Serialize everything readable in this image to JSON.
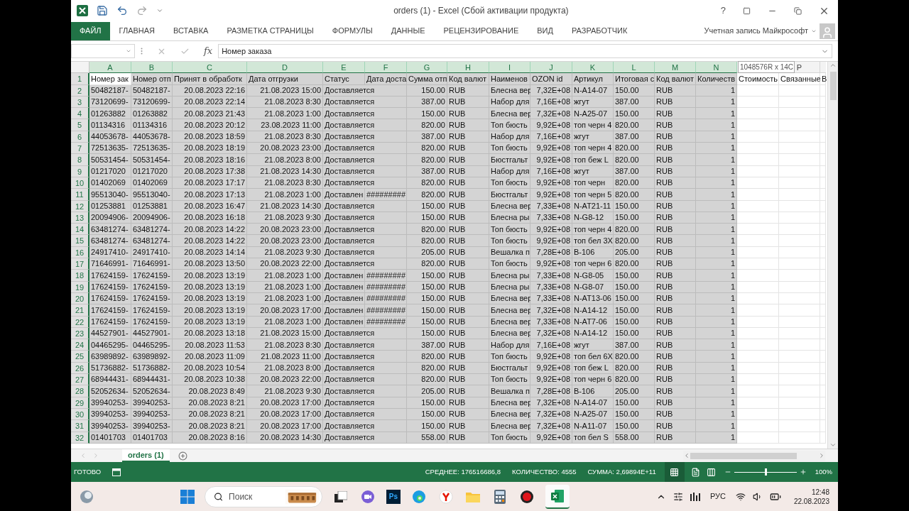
{
  "window": {
    "title": "orders (1) - Excel (Сбой активации продукта)",
    "help": "?"
  },
  "ribbon_tabs": [
    {
      "label": "ФАЙЛ",
      "kind": "file"
    },
    {
      "label": "ГЛАВНАЯ",
      "kind": "tab"
    },
    {
      "label": "ВСТАВКА",
      "kind": "tab"
    },
    {
      "label": "РАЗМЕТКА СТРАНИЦЫ",
      "kind": "tab"
    },
    {
      "label": "ФОРМУЛЫ",
      "kind": "tab"
    },
    {
      "label": "ДАННЫЕ",
      "kind": "tab"
    },
    {
      "label": "РЕЦЕНЗИРОВАНИЕ",
      "kind": "tab"
    },
    {
      "label": "ВИД",
      "kind": "tab"
    },
    {
      "label": "РАЗРАБОТЧИК",
      "kind": "tab"
    }
  ],
  "account": "Учетная запись Майкрософт",
  "formula_bar": {
    "function_label": "fx",
    "content": "Номер заказа"
  },
  "column_headers": [
    {
      "label": "A",
      "selected": true
    },
    {
      "label": "B",
      "selected": true
    },
    {
      "label": "C",
      "selected": true
    },
    {
      "label": "D",
      "selected": true
    },
    {
      "label": "E",
      "selected": true
    },
    {
      "label": "F",
      "selected": true
    },
    {
      "label": "G",
      "selected": true
    },
    {
      "label": "H",
      "selected": true
    },
    {
      "label": "I",
      "selected": true
    },
    {
      "label": "J",
      "selected": true
    },
    {
      "label": "K",
      "selected": true
    },
    {
      "label": "L",
      "selected": true
    },
    {
      "label": "M",
      "selected": true
    },
    {
      "label": "N",
      "selected": true
    },
    {
      "tooltip": "1048576R x 14C",
      "selected": false
    },
    {
      "label": "P",
      "selected": false
    }
  ],
  "rows": [
    {
      "number": "1",
      "selected": true,
      "active": true,
      "A": "Номер зак",
      "B": "Номер отп",
      "C": "Принят в обработк",
      "D": "Дата отгрузки",
      "E": "Статус",
      "F": "Дата доста",
      "G": "Сумма отп",
      "H": "Код валют",
      "I": "Наименов",
      "J": "OZON id",
      "K": "Артикул",
      "L": "Итоговая с",
      "M": "Код валют",
      "N": "Количеств",
      "O": "Стоимость",
      "P": "Связанные",
      "Q": "В"
    },
    {
      "number": "2",
      "selected": true,
      "active": false,
      "A": "50482187-",
      "B": "50482187-",
      "C": "20.08.2023 22:16",
      "D": "21.08.2023 15:00",
      "E": "Доставляется",
      "G": "150.00",
      "H": "RUB",
      "I": "Блесна вер",
      "J": "7,32E+08",
      "K": "N-A14-07",
      "L": "150.00",
      "M": "RUB",
      "N": "1"
    },
    {
      "number": "3",
      "selected": true,
      "active": false,
      "A": "73120699-",
      "B": "73120699-",
      "C": "20.08.2023 22:14",
      "D": "21.08.2023 8:30",
      "E": "Доставляется",
      "G": "387.00",
      "H": "RUB",
      "I": "Набор для",
      "J": "7,16E+08",
      "K": "жгут",
      "L": "387.00",
      "M": "RUB",
      "N": "1"
    },
    {
      "number": "4",
      "selected": true,
      "active": false,
      "A": "01263882",
      "B": "01263882",
      "C": "20.08.2023 21:43",
      "D": "21.08.2023 1:00",
      "E": "Доставляется",
      "G": "150.00",
      "H": "RUB",
      "I": "Блесна вер",
      "J": "7,32E+08",
      "K": "N-A25-07",
      "L": "150.00",
      "M": "RUB",
      "N": "1"
    },
    {
      "number": "5",
      "selected": true,
      "active": false,
      "A": "01134316",
      "B": "01134316",
      "C": "20.08.2023 20:12",
      "D": "23.08.2023 11:00",
      "E": "Доставляется",
      "G": "820.00",
      "H": "RUB",
      "I": "Топ бюсть",
      "J": "9,92E+08",
      "K": "топ черн 4",
      "L": "820.00",
      "M": "RUB",
      "N": "1"
    },
    {
      "number": "6",
      "selected": true,
      "active": false,
      "A": "44053678-",
      "B": "44053678-",
      "C": "20.08.2023 18:59",
      "D": "21.08.2023 8:30",
      "E": "Доставляется",
      "G": "387.00",
      "H": "RUB",
      "I": "Набор для",
      "J": "7,16E+08",
      "K": "жгут",
      "L": "387.00",
      "M": "RUB",
      "N": "1"
    },
    {
      "number": "7",
      "selected": true,
      "active": false,
      "A": "72513635-",
      "B": "72513635-",
      "C": "20.08.2023 18:19",
      "D": "20.08.2023 23:00",
      "E": "Доставляется",
      "G": "820.00",
      "H": "RUB",
      "I": "Топ бюсть",
      "J": "9,92E+08",
      "K": "топ черн 4",
      "L": "820.00",
      "M": "RUB",
      "N": "1"
    },
    {
      "number": "8",
      "selected": true,
      "active": false,
      "A": "50531454-",
      "B": "50531454-",
      "C": "20.08.2023 18:16",
      "D": "21.08.2023 8:00",
      "E": "Доставляется",
      "G": "820.00",
      "H": "RUB",
      "I": "Бюстгальт",
      "J": "9,92E+08",
      "K": "топ беж L",
      "L": "820.00",
      "M": "RUB",
      "N": "1"
    },
    {
      "number": "9",
      "selected": true,
      "active": false,
      "A": "01217020",
      "B": "01217020",
      "C": "20.08.2023 17:38",
      "D": "21.08.2023 14:30",
      "E": "Доставляется",
      "G": "387.00",
      "H": "RUB",
      "I": "Набор для",
      "J": "7,16E+08",
      "K": "жгут",
      "L": "387.00",
      "M": "RUB",
      "N": "1"
    },
    {
      "number": "10",
      "selected": true,
      "active": false,
      "A": "01402069",
      "B": "01402069",
      "C": "20.08.2023 17:17",
      "D": "21.08.2023 8:30",
      "E": "Доставляется",
      "G": "820.00",
      "H": "RUB",
      "I": "Топ бюсть",
      "J": "9,92E+08",
      "K": "топ черн",
      "L": "820.00",
      "M": "RUB",
      "N": "1"
    },
    {
      "number": "11",
      "selected": true,
      "active": false,
      "A": "95513040-",
      "B": "95513040-",
      "C": "20.08.2023 17:13",
      "D": "21.08.2023 1:00",
      "E": "Доставлен",
      "F": "#########",
      "G": "820.00",
      "H": "RUB",
      "I": "Бюстгальт",
      "J": "9,92E+08",
      "K": "топ черн 5",
      "L": "820.00",
      "M": "RUB",
      "N": "1"
    },
    {
      "number": "12",
      "selected": true,
      "active": false,
      "A": "01253881",
      "B": "01253881",
      "C": "20.08.2023 16:47",
      "D": "21.08.2023 14:30",
      "E": "Доставляется",
      "G": "150.00",
      "H": "RUB",
      "I": "Блесна вер",
      "J": "7,33E+08",
      "K": "N-AT21-11",
      "L": "150.00",
      "M": "RUB",
      "N": "1"
    },
    {
      "number": "13",
      "selected": true,
      "active": false,
      "A": "20094906-",
      "B": "20094906-",
      "C": "20.08.2023 16:18",
      "D": "21.08.2023 9:30",
      "E": "Доставляется",
      "G": "150.00",
      "H": "RUB",
      "I": "Блесна ры",
      "J": "7,33E+08",
      "K": "N-G8-12",
      "L": "150.00",
      "M": "RUB",
      "N": "1"
    },
    {
      "number": "14",
      "selected": true,
      "active": false,
      "A": "63481274-",
      "B": "63481274-",
      "C": "20.08.2023 14:22",
      "D": "20.08.2023 23:00",
      "E": "Доставляется",
      "G": "820.00",
      "H": "RUB",
      "I": "Топ бюсть",
      "J": "9,92E+08",
      "K": "топ черн 4",
      "L": "820.00",
      "M": "RUB",
      "N": "1"
    },
    {
      "number": "15",
      "selected": true,
      "active": false,
      "A": "63481274-",
      "B": "63481274-",
      "C": "20.08.2023 14:22",
      "D": "20.08.2023 23:00",
      "E": "Доставляется",
      "G": "820.00",
      "H": "RUB",
      "I": "Топ бюсть",
      "J": "9,92E+08",
      "K": "топ бел 3Х",
      "L": "820.00",
      "M": "RUB",
      "N": "1"
    },
    {
      "number": "16",
      "selected": true,
      "active": false,
      "A": "24917410-",
      "B": "24917410-",
      "C": "20.08.2023 14:14",
      "D": "21.08.2023 9:30",
      "E": "Доставляется",
      "G": "205.00",
      "H": "RUB",
      "I": "Вешалка п",
      "J": "7,28E+08",
      "K": "B-106",
      "L": "205.00",
      "M": "RUB",
      "N": "1"
    },
    {
      "number": "17",
      "selected": true,
      "active": false,
      "A": "71646991-",
      "B": "71646991-",
      "C": "20.08.2023 13:50",
      "D": "20.08.2023 22:00",
      "E": "Доставляется",
      "G": "820.00",
      "H": "RUB",
      "I": "Топ бюсть",
      "J": "9,92E+08",
      "K": "топ черн 6",
      "L": "820.00",
      "M": "RUB",
      "N": "1"
    },
    {
      "number": "18",
      "selected": true,
      "active": false,
      "A": "17624159-",
      "B": "17624159-",
      "C": "20.08.2023 13:19",
      "D": "21.08.2023 1:00",
      "E": "Доставлен",
      "F": "#########",
      "G": "150.00",
      "H": "RUB",
      "I": "Блесна ры",
      "J": "7,33E+08",
      "K": "N-G8-05",
      "L": "150.00",
      "M": "RUB",
      "N": "1"
    },
    {
      "number": "19",
      "selected": true,
      "active": false,
      "A": "17624159-",
      "B": "17624159-",
      "C": "20.08.2023 13:19",
      "D": "21.08.2023 1:00",
      "E": "Доставлен",
      "F": "#########",
      "G": "150.00",
      "H": "RUB",
      "I": "Блесна ры",
      "J": "7,33E+08",
      "K": "N-G8-07",
      "L": "150.00",
      "M": "RUB",
      "N": "1"
    },
    {
      "number": "20",
      "selected": true,
      "active": false,
      "A": "17624159-",
      "B": "17624159-",
      "C": "20.08.2023 13:19",
      "D": "21.08.2023 1:00",
      "E": "Доставлен",
      "F": "#########",
      "G": "150.00",
      "H": "RUB",
      "I": "Блесна вер",
      "J": "7,33E+08",
      "K": "N-AT13-06",
      "L": "150.00",
      "M": "RUB",
      "N": "1"
    },
    {
      "number": "21",
      "selected": true,
      "active": false,
      "A": "17624159-",
      "B": "17624159-",
      "C": "20.08.2023 13:19",
      "D": "20.08.2023 17:00",
      "E": "Доставлен",
      "F": "#########",
      "G": "150.00",
      "H": "RUB",
      "I": "Блесна вер",
      "J": "7,32E+08",
      "K": "N-A14-12",
      "L": "150.00",
      "M": "RUB",
      "N": "1"
    },
    {
      "number": "22",
      "selected": true,
      "active": false,
      "A": "17624159-",
      "B": "17624159-",
      "C": "20.08.2023 13:19",
      "D": "21.08.2023 1:00",
      "E": "Доставлен",
      "F": "#########",
      "G": "150.00",
      "H": "RUB",
      "I": "Блесна вер",
      "J": "7,33E+08",
      "K": "N-AT7-06",
      "L": "150.00",
      "M": "RUB",
      "N": "1"
    },
    {
      "number": "23",
      "selected": true,
      "active": false,
      "A": "44527901-",
      "B": "44527901-",
      "C": "20.08.2023 13:18",
      "D": "21.08.2023 15:00",
      "E": "Доставляется",
      "G": "150.00",
      "H": "RUB",
      "I": "Блесна вер",
      "J": "7,32E+08",
      "K": "N-A14-12",
      "L": "150.00",
      "M": "RUB",
      "N": "1"
    },
    {
      "number": "24",
      "selected": true,
      "active": false,
      "A": "04465295-",
      "B": "04465295-",
      "C": "20.08.2023 11:53",
      "D": "21.08.2023 8:30",
      "E": "Доставляется",
      "G": "387.00",
      "H": "RUB",
      "I": "Набор для",
      "J": "7,16E+08",
      "K": "жгут",
      "L": "387.00",
      "M": "RUB",
      "N": "1"
    },
    {
      "number": "25",
      "selected": true,
      "active": false,
      "A": "63989892-",
      "B": "63989892-",
      "C": "20.08.2023 11:09",
      "D": "21.08.2023 11:00",
      "E": "Доставляется",
      "G": "820.00",
      "H": "RUB",
      "I": "Топ бюсть",
      "J": "9,92E+08",
      "K": "топ бел 6Х",
      "L": "820.00",
      "M": "RUB",
      "N": "1"
    },
    {
      "number": "26",
      "selected": true,
      "active": false,
      "A": "51736882-",
      "B": "51736882-",
      "C": "20.08.2023 10:54",
      "D": "21.08.2023 8:00",
      "E": "Доставляется",
      "G": "820.00",
      "H": "RUB",
      "I": "Бюстгальт",
      "J": "9,92E+08",
      "K": "топ беж L",
      "L": "820.00",
      "M": "RUB",
      "N": "1"
    },
    {
      "number": "27",
      "selected": true,
      "active": false,
      "A": "68944431-",
      "B": "68944431-",
      "C": "20.08.2023 10:38",
      "D": "20.08.2023 22:00",
      "E": "Доставляется",
      "G": "820.00",
      "H": "RUB",
      "I": "Топ бюсть",
      "J": "9,92E+08",
      "K": "топ черн 6",
      "L": "820.00",
      "M": "RUB",
      "N": "1"
    },
    {
      "number": "28",
      "selected": true,
      "active": false,
      "A": "52052634-",
      "B": "52052634-",
      "C": "20.08.2023 8:49",
      "D": "21.08.2023 9:30",
      "E": "Доставляется",
      "G": "205.00",
      "H": "RUB",
      "I": "Вешалка п",
      "J": "7,28E+08",
      "K": "B-106",
      "L": "205.00",
      "M": "RUB",
      "N": "1"
    },
    {
      "number": "29",
      "selected": true,
      "active": false,
      "A": "39940253-",
      "B": "39940253-",
      "C": "20.08.2023 8:21",
      "D": "20.08.2023 17:00",
      "E": "Доставляется",
      "G": "150.00",
      "H": "RUB",
      "I": "Блесна вер",
      "J": "7,32E+08",
      "K": "N-A14-07",
      "L": "150.00",
      "M": "RUB",
      "N": "1"
    },
    {
      "number": "30",
      "selected": true,
      "active": false,
      "A": "39940253-",
      "B": "39940253-",
      "C": "20.08.2023 8:21",
      "D": "20.08.2023 17:00",
      "E": "Доставляется",
      "G": "150.00",
      "H": "RUB",
      "I": "Блесна вер",
      "J": "7,32E+08",
      "K": "N-A25-07",
      "L": "150.00",
      "M": "RUB",
      "N": "1"
    },
    {
      "number": "31",
      "selected": true,
      "active": false,
      "A": "39940253-",
      "B": "39940253-",
      "C": "20.08.2023 8:21",
      "D": "20.08.2023 17:00",
      "E": "Доставляется",
      "G": "150.00",
      "H": "RUB",
      "I": "Блесна вер",
      "J": "7,32E+08",
      "K": "N-A11-07",
      "L": "150.00",
      "M": "RUB",
      "N": "1"
    },
    {
      "number": "32",
      "selected": true,
      "active": false,
      "A": "01401703",
      "B": "01401703",
      "C": "20.08.2023 8:16",
      "D": "20.08.2023 14:30",
      "E": "Доставляется",
      "G": "558.00",
      "H": "RUB",
      "I": "Топ бюсть",
      "J": "9,92E+08",
      "K": "топ бел S",
      "L": "558.00",
      "M": "RUB",
      "N": "1"
    }
  ],
  "sheet_tabs": [
    {
      "label": "orders (1)",
      "selected": true
    }
  ],
  "status_bar": {
    "state": "ГОТОВО",
    "average": "СРЕДНЕЕ: 176516686,8",
    "count": "КОЛИЧЕСТВО: 4555",
    "sum": "СУММА: 2,69894E+11",
    "zoom": {
      "level": 0.5,
      "reading": "100%"
    }
  },
  "taskbar": {
    "search_placeholder": "Поиск",
    "ps_label": "Ps",
    "language": "РУС",
    "time": "12:48",
    "date": "22.08.2023"
  }
}
